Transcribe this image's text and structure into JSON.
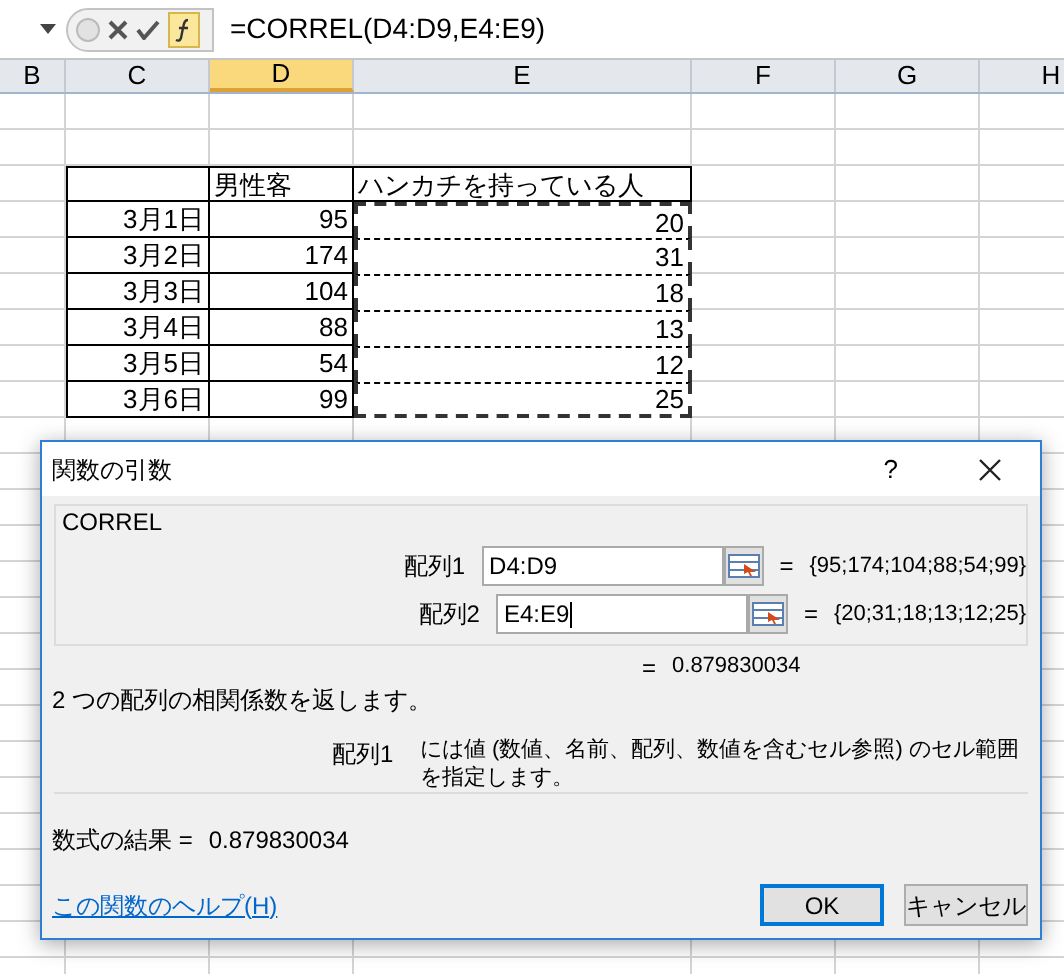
{
  "formula_bar": {
    "formula": "=CORREL(D4:D9,E4:E9)"
  },
  "column_headers": [
    {
      "label": "B",
      "selected": false
    },
    {
      "label": "C",
      "selected": false
    },
    {
      "label": "D",
      "selected": true
    },
    {
      "label": "E",
      "selected": false
    },
    {
      "label": "F",
      "selected": false
    },
    {
      "label": "G",
      "selected": false
    },
    {
      "label": "H",
      "selected": false
    }
  ],
  "table": {
    "columns": [
      {
        "label": "男性客"
      },
      {
        "label": "ハンカチを持っている人"
      }
    ],
    "marquee": true,
    "rows": [
      {
        "date": "3月1日",
        "male": "95",
        "handkerchief": "20"
      },
      {
        "date": "3月2日",
        "male": "174",
        "handkerchief": "31"
      },
      {
        "date": "3月3日",
        "male": "104",
        "handkerchief": "18"
      },
      {
        "date": "3月4日",
        "male": "88",
        "handkerchief": "13"
      },
      {
        "date": "3月5日",
        "male": "54",
        "handkerchief": "12"
      },
      {
        "date": "3月6日",
        "male": "99",
        "handkerchief": "25"
      }
    ]
  },
  "dialog": {
    "title": "関数の引数",
    "help": "?",
    "function_name": "CORREL",
    "arguments": [
      {
        "label": "配列1",
        "value": "D4:D9",
        "equals": "=",
        "preview": "{95;174;104;88;54;99}",
        "focused": false
      },
      {
        "label": "配列2",
        "value": "E4:E9",
        "equals": "=",
        "preview": "{20;31;18;13;12;25}",
        "focused": true
      }
    ],
    "result_equals": "=",
    "result_preview": "0.879830034",
    "description": "2 つの配列の相関係数を返します。",
    "argument_help": {
      "name": "配列1",
      "text": "には値 (数値、名前、配列、数値を含むセル参照) のセル範囲を指定します。"
    },
    "formula_result": {
      "label": "数式の結果 =",
      "value": "0.879830034"
    },
    "help_link": "この関数のヘルプ(H)",
    "buttons": [
      {
        "label": "OK",
        "default": true
      },
      {
        "label": "キャンセル",
        "default": false
      }
    ]
  }
}
